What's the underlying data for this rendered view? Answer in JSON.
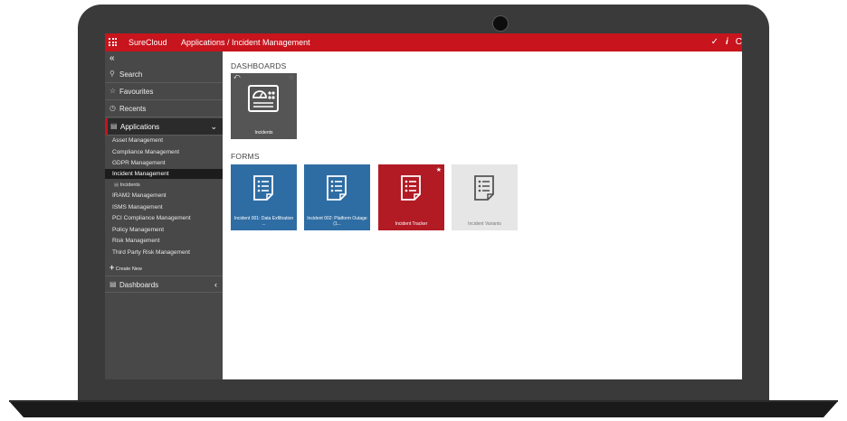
{
  "topbar": {
    "brand": "SureCloud",
    "breadcrumb": "Applications / Incident Management",
    "check_icon": "✓",
    "info_icon": "i",
    "refresh_icon": "C"
  },
  "sidebar": {
    "collapse_glyph": "«",
    "search": "Search",
    "favourites": "Favourites",
    "recents": "Recents",
    "applications": "Applications",
    "apps": [
      "Asset Management",
      "Compliance Management",
      "GDPR Management",
      "Incident Management",
      "Incidents",
      "IRAM2 Management",
      "ISMS Management",
      "PCI Compliance Management",
      "Policy Management",
      "Risk Management",
      "Third Party Risk Management"
    ],
    "create_new": "Create New",
    "dashboards": "Dashboards"
  },
  "main": {
    "dashboards_title": "DASHBOARDS",
    "dashboard_tile": "Incidents",
    "forms_title": "FORMS",
    "forms": [
      "Incident 001: Data Exfiltration ...",
      "Incident 002: Platform Outage (1...",
      "Incident Tracker",
      "Incident Variants"
    ]
  },
  "colors": {
    "brand_red": "#c8141d",
    "tile_blue": "#2e6da4",
    "tile_red": "#b21b24",
    "sidebar_bg": "#484848"
  }
}
